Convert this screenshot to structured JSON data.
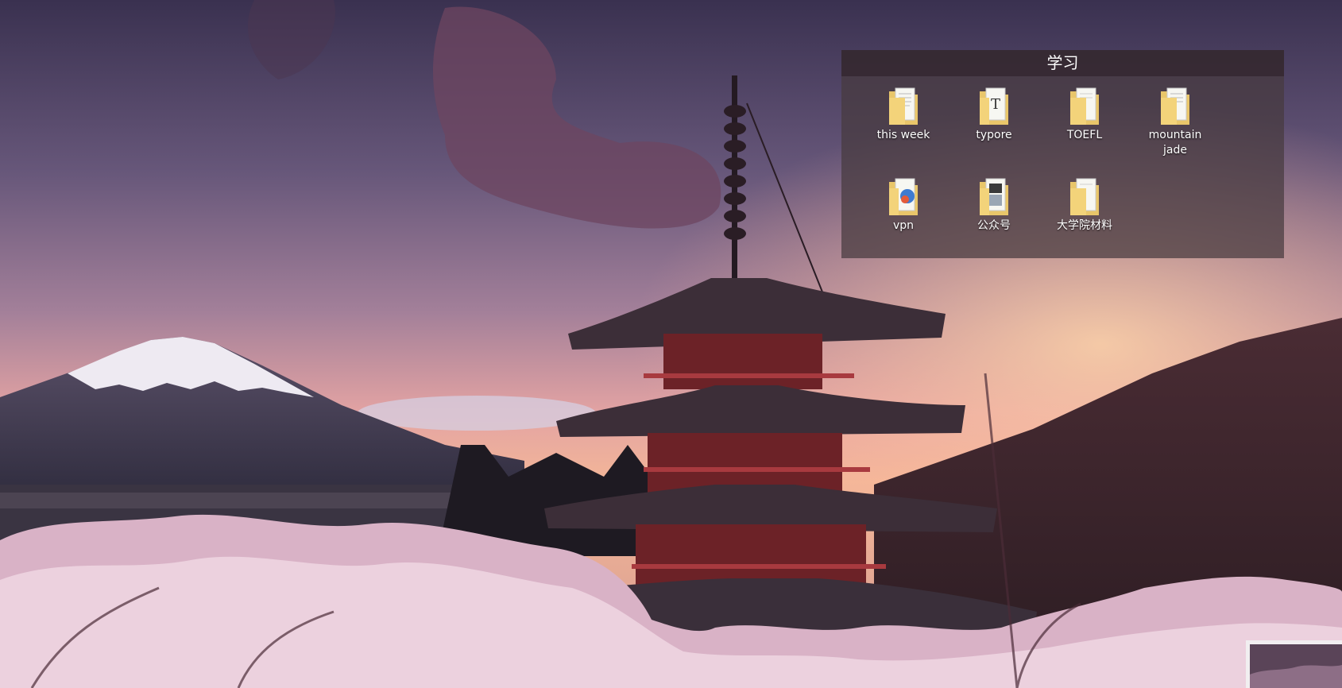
{
  "fence": {
    "title": "学习",
    "items": [
      {
        "label": "this week",
        "icon": "folder-documents-icon"
      },
      {
        "label": "typore",
        "icon": "folder-typora-icon"
      },
      {
        "label": "TOEFL",
        "icon": "folder-documents-icon"
      },
      {
        "label": "mountain\njade",
        "icon": "folder-documents-icon"
      },
      {
        "label": "vpn",
        "icon": "folder-vpn-icon"
      },
      {
        "label": "公众号",
        "icon": "folder-images-icon"
      },
      {
        "label": "大学院材料",
        "icon": "folder-documents-icon"
      }
    ]
  },
  "wallpaper": {
    "icon": "chureito-pagoda-mount-fuji-wallpaper",
    "colors": {
      "sky_top": "#3d3350",
      "sky_glow": "#f4a98f",
      "blossom": "#e7c6d6"
    }
  }
}
